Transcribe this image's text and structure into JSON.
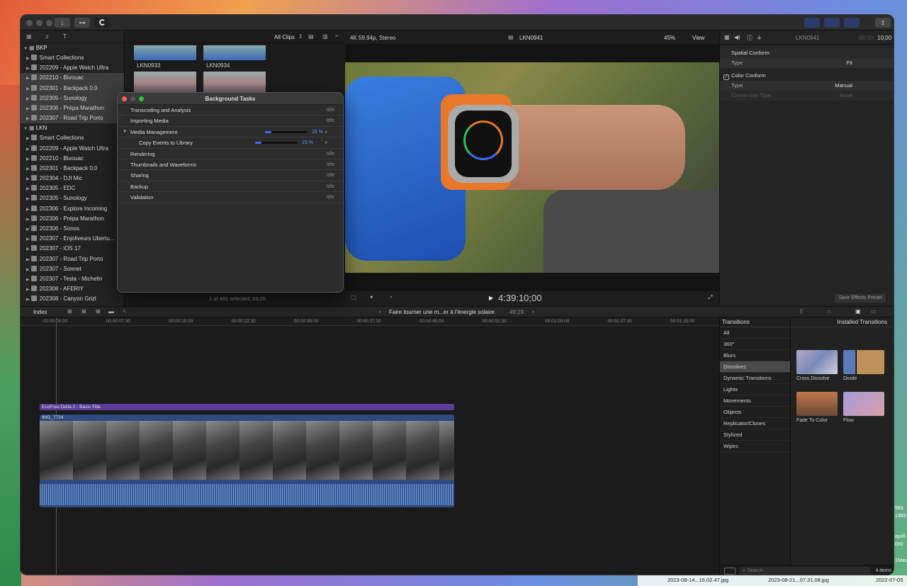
{
  "colors": {
    "accent": "#3b6df0",
    "title_clip": "#5b3e9a",
    "video_clip": "#2f4a80"
  },
  "toolbar": {
    "import_icon": "download-icon",
    "keywords_icon": "key-icon",
    "bg_tasks_icon": "progress-icon"
  },
  "sidebar": {
    "libraries": [
      {
        "name": "BKP",
        "events": [
          "Smart Collections",
          "202209 - Apple Watch Ultra",
          "202210 - Bivouac",
          "202301 - Backpack 0.0",
          "202305 - Sunology",
          "202306 - Prépa Marathon",
          "202307 - Road Trip Porto"
        ]
      },
      {
        "name": "LKN",
        "events": [
          "Smart Collections",
          "202209 - Apple Watch Ultra",
          "202210 - Bivouac",
          "202301 - Backpack 0.0",
          "202304 - DJI Mic",
          "202305 - EDC",
          "202305 - Sunology",
          "202306 - Explore Incoming",
          "202306 - Prépa Marathon",
          "202306 - Sonos",
          "202307 - Enjoliveurs Ubertu...",
          "202307 - iOS 17",
          "202307 - Road Trip Porto",
          "202307 - Sonnet",
          "202307 - Tesla - Michelin",
          "202308 - AFERIY",
          "202308 - Canyon Grizl"
        ]
      }
    ]
  },
  "browser": {
    "filter": "All Clips",
    "clips": [
      "LKN0933",
      "LKN0934"
    ],
    "status": "1 of 491 selected, 03;05"
  },
  "viewer": {
    "format": "4K 59.94p, Stereo",
    "clip_name": "LKN0941",
    "zoom": "45%",
    "view_menu": "View",
    "timecode": "4:39:10;00"
  },
  "inspector": {
    "clip_name": "LKN0941",
    "duration_prefix": "00:00:",
    "duration": "10;00",
    "spatial_title": "Spatial Conform",
    "spatial_type_label": "Type",
    "spatial_type_value": "Fit",
    "color_title": "Color Conform",
    "color_type_label": "Type",
    "color_type_value": "Manual",
    "conversion_label": "Conversion Type",
    "conversion_value": "None",
    "save_preset": "Save Effects Preset"
  },
  "timeline_bar": {
    "index": "Index",
    "project": "Faire tourner une m...er à l'énergie solaire",
    "duration": "49:29"
  },
  "ruler": [
    "00:00:00:00",
    "00:00:07:30",
    "00:00:15:00",
    "00:00:22:30",
    "00:00:30:00",
    "00:00:37:30",
    "00:00:45:00",
    "00:00:52:30",
    "00:01:00:00",
    "00:01:07:30",
    "00:01:15:00"
  ],
  "clips": {
    "title": "EcoFlow Delta 2 - Basic Title",
    "video": "IMG_7734"
  },
  "transitions": {
    "header": "Transitions",
    "installed": "Installed Transitions",
    "count": "4 items",
    "search_placeholder": "Search",
    "categories": [
      "All",
      "360°",
      "Blurs",
      "Dissolves",
      "Dynamic Transitions",
      "Lights",
      "Movements",
      "Objects",
      "Replicator/Clones",
      "Stylized",
      "Wipes"
    ],
    "items": [
      "Cross Dissolve",
      "Divide",
      "Fade To Color",
      "Flow"
    ]
  },
  "dialog": {
    "title": "Background Tasks",
    "tasks": [
      {
        "name": "Transcoding and Analysis",
        "status": "Idle"
      },
      {
        "name": "Importing Media",
        "status": "Idle"
      },
      {
        "name": "Media Management",
        "status": "15 %",
        "progress": 0.15
      },
      {
        "name": "Copy Events to Library",
        "status": "15 %",
        "progress": 0.15
      },
      {
        "name": "Rendering",
        "status": "Idle"
      },
      {
        "name": "Thumbnails and Waveforms",
        "status": "Idle"
      },
      {
        "name": "Sharing",
        "status": "Idle"
      },
      {
        "name": "Backup",
        "status": "Idle"
      },
      {
        "name": "Validation",
        "status": "Idle"
      }
    ]
  },
  "desktop_files": [
    "2023-08-14...16.02.47.jpg",
    "2023-08-21...07.31.08.jpg",
    "2022-07-05"
  ],
  "desktop_edge": [
    "983.",
    "1383",
    "ayoll",
    "000",
    "1Max"
  ]
}
